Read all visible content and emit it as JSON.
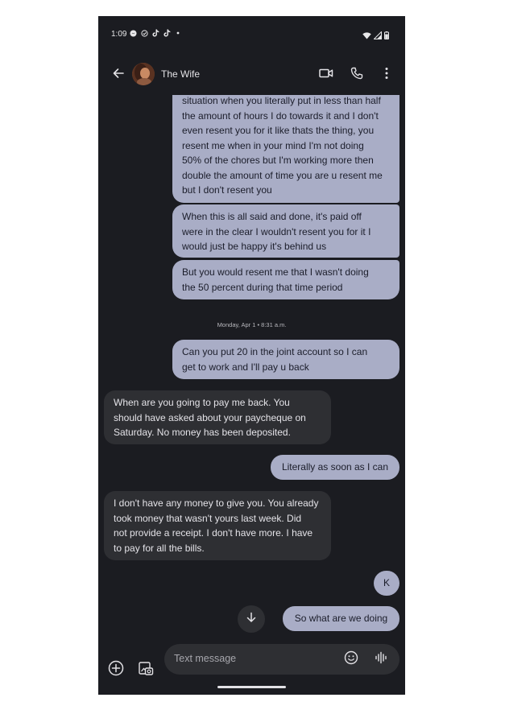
{
  "status_bar": {
    "time": "1:09",
    "left_icons": [
      "messenger-icon",
      "check-circle-icon",
      "tiktok-icon",
      "tiktok-icon",
      "dot-icon"
    ],
    "right_icons": [
      "wifi-icon",
      "signal-icon",
      "battery-icon"
    ]
  },
  "header": {
    "back_icon": "arrow-left-icon",
    "contact_name": "The Wife",
    "actions": [
      "video-call-icon",
      "phone-icon",
      "more-vert-icon"
    ]
  },
  "conversation": {
    "messages": [
      {
        "direction": "outgoing",
        "lines": [
          "situation when you literally put in less than half",
          "the amount of hours I do towards it and I don't",
          "even resent you for it like thats the thing, you",
          "resent me when in your mind I'm not doing",
          "50% of the chores but I'm working more then",
          "double the amount of time you are u resent me",
          "but I don't resent you"
        ]
      },
      {
        "direction": "outgoing",
        "lines": [
          "When this is all said and done, it's paid off",
          "were in the clear I wouldn't resent you for it I",
          "would just be happy it's behind us"
        ]
      },
      {
        "direction": "outgoing",
        "lines": [
          "But you would resent me that I wasn't doing",
          "the 50 percent during that time period"
        ]
      },
      {
        "direction": "outgoing",
        "lines": [
          "Can you put 20 in the joint account so I can",
          "get to work and I'll pay u back"
        ]
      },
      {
        "direction": "incoming",
        "lines": [
          "When are you going to pay me back. You",
          "should have asked about your paycheque on",
          "Saturday. No money has been deposited."
        ]
      },
      {
        "direction": "outgoing",
        "lines": [
          "Literally as soon as I can"
        ]
      },
      {
        "direction": "incoming",
        "lines": [
          "I don't have any money to give you. You already",
          "took money that wasn't yours last week. Did",
          "not provide a receipt. I don't have more. I have",
          "to pay for all the bills."
        ]
      },
      {
        "direction": "outgoing",
        "lines": [
          "K"
        ]
      },
      {
        "direction": "outgoing",
        "lines": [
          "So what are we doing"
        ]
      }
    ],
    "timestamp": "Monday, Apr 1 • 8:31 a.m."
  },
  "compose": {
    "placeholder": "Text message",
    "icons": [
      "add-circle-icon",
      "gallery-icon",
      "emoji-icon",
      "voice-icon"
    ]
  },
  "colors": {
    "background": "#1b1c21",
    "outgoing_bubble": "#a9adc6",
    "incoming_bubble": "#2e2f33"
  }
}
